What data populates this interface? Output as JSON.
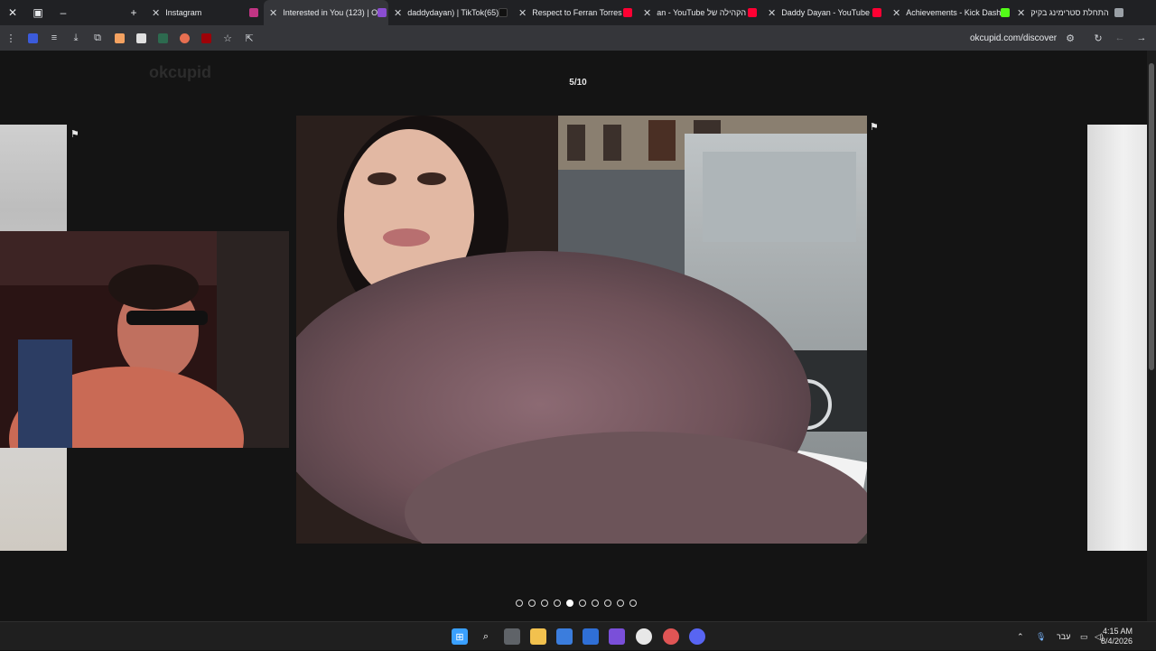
{
  "tabs": [
    {
      "label": "Instagram",
      "color": "#c13584",
      "active": false
    },
    {
      "label": "Interested in You (123) | O",
      "color": "#8a4dd1",
      "active": true
    },
    {
      "label": "daddydayan) | TikTok(65)",
      "color": "#111111",
      "active": false
    },
    {
      "label": "Respect to Ferran Torres",
      "color": "#ff0033",
      "active": false
    },
    {
      "label": "an - YouTube הקהילה של",
      "color": "#ff0033",
      "active": false
    },
    {
      "label": "Daddy Dayan - YouTube",
      "color": "#ff0033",
      "active": false
    },
    {
      "label": "Achievements - Kick Dash",
      "color": "#53fc18",
      "active": false
    },
    {
      "label": "התחלת סטרימינג בקיק",
      "color": "#9aa0a6",
      "active": false
    }
  ],
  "address": {
    "url": "okcupid.com/discover"
  },
  "viewer": {
    "counter": "5/10",
    "total_photos": 10,
    "current_photo": 5
  },
  "background": {
    "logo": "okcupid"
  },
  "taskbar": {
    "language": "עבר",
    "time": "4:15 AM",
    "date": "8/4/2026"
  },
  "colors": {
    "accent": "#ffffff",
    "brand": "#8a4dd1",
    "windows_blue": "#3aa0ff"
  }
}
